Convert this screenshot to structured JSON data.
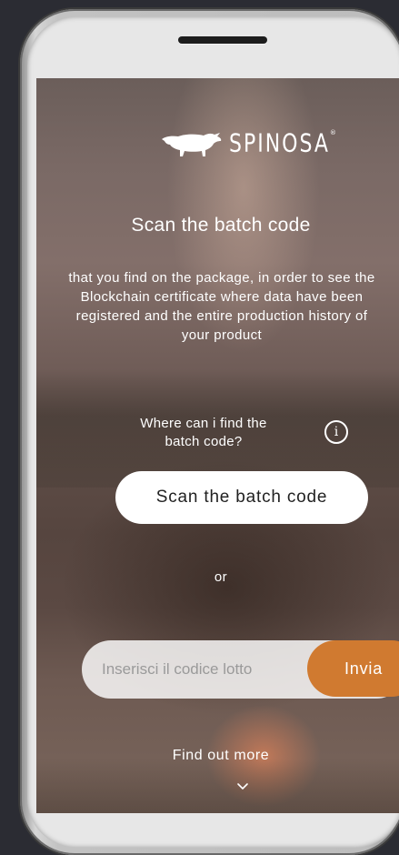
{
  "brand": {
    "name": "SPINOSA",
    "mark": "®"
  },
  "main": {
    "title": "Scan the batch code",
    "description": "that you find on the package, in order to see the Blockchain certificate where data have been registered and the entire production history of your product",
    "help_text": "Where can i find the batch code?",
    "info_icon": "i",
    "scan_button_label": "Scan the batch code",
    "or_text": "or"
  },
  "code_form": {
    "placeholder": "Inserisci il codice lotto",
    "value": "",
    "submit_label": "Invia"
  },
  "footer": {
    "find_out_more": "Find out more"
  },
  "icons": {
    "logo": "bull-logo-icon",
    "info": "info-icon",
    "chevron": "chevron-down-icon"
  },
  "colors": {
    "accent": "#d07a30",
    "button_bg": "#ffffff",
    "text": "#ffffff"
  }
}
